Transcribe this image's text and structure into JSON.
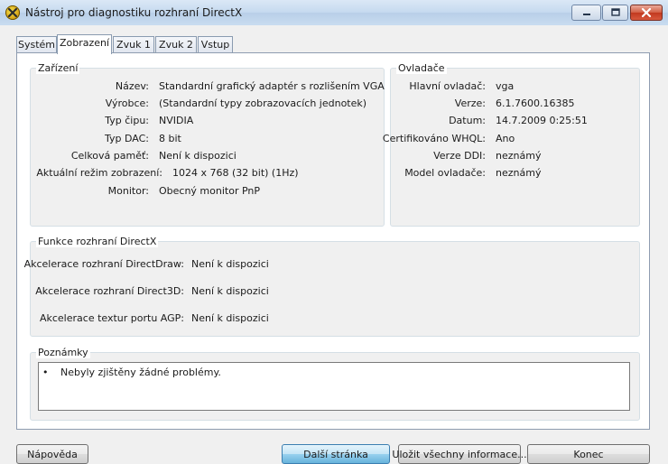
{
  "window": {
    "title": "Nástroj pro diagnostiku rozhraní DirectX"
  },
  "tabs": [
    {
      "label": "Systém"
    },
    {
      "label": "Zobrazení"
    },
    {
      "label": "Zvuk 1"
    },
    {
      "label": "Zvuk 2"
    },
    {
      "label": "Vstup"
    }
  ],
  "device": {
    "title": "Zařízení",
    "rows": [
      {
        "label": "Název:",
        "value": "Standardní grafický adaptér s rozlišením VGA"
      },
      {
        "label": "Výrobce:",
        "value": "(Standardní typy zobrazovacích jednotek)"
      },
      {
        "label": "Typ čipu:",
        "value": "NVIDIA"
      },
      {
        "label": "Typ DAC:",
        "value": "8 bit"
      },
      {
        "label": "Celková paměť:",
        "value": "Není k dispozici"
      },
      {
        "label": "Aktuální režim zobrazení:",
        "value": "1024 x 768 (32 bit) (1Hz)"
      },
      {
        "label": "Monitor:",
        "value": "Obecný monitor PnP"
      }
    ]
  },
  "drivers": {
    "title": "Ovladače",
    "rows": [
      {
        "label": "Hlavní ovladač:",
        "value": "vga"
      },
      {
        "label": "Verze:",
        "value": "6.1.7600.16385"
      },
      {
        "label": "Datum:",
        "value": "14.7.2009 0:25:51"
      },
      {
        "label": "Certifikováno WHQL:",
        "value": "Ano"
      },
      {
        "label": "Verze DDI:",
        "value": "neznámý"
      },
      {
        "label": "Model ovladače:",
        "value": "neznámý"
      }
    ]
  },
  "features": {
    "title": "Funkce rozhraní DirectX",
    "rows": [
      {
        "label": "Akcelerace rozhraní DirectDraw:",
        "value": "Není k dispozici"
      },
      {
        "label": "Akcelerace rozhraní Direct3D:",
        "value": "Není k dispozici"
      },
      {
        "label": "Akcelerace textur portu AGP:",
        "value": "Není k dispozici"
      }
    ]
  },
  "notes": {
    "title": "Poznámky",
    "bullet": "•",
    "items": [
      "Nebyly zjištěny žádné problémy."
    ]
  },
  "buttons": {
    "help": "Nápověda",
    "next_page": "Další stránka",
    "save_all": "Uložit všechny informace...",
    "exit": "Konec"
  },
  "icons": {
    "app": "directx-icon",
    "minimize": "minimize-icon",
    "maximize": "maximize-icon",
    "close": "close-icon"
  },
  "colors": {
    "titlebar": "#c5d9ef",
    "close_button": "#c1391f",
    "default_button": "#98d1ef",
    "group_border": "#d5dfe5"
  }
}
